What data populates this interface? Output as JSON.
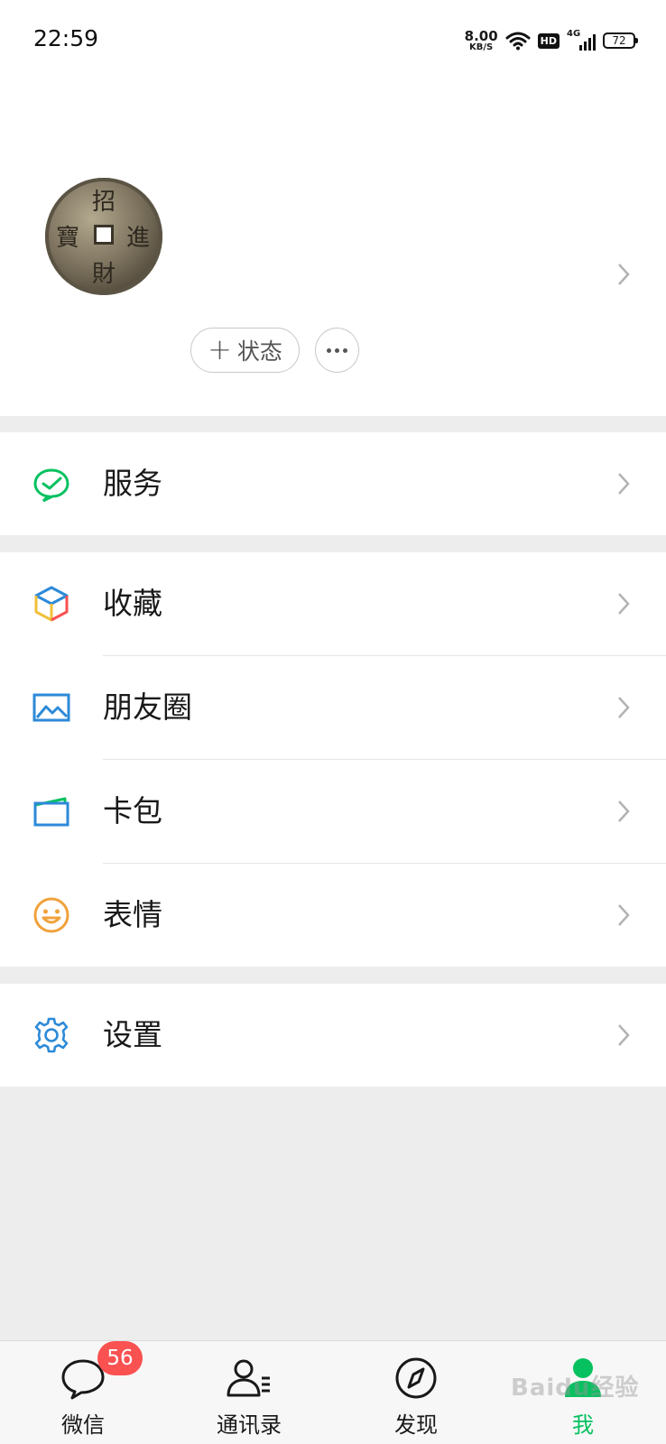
{
  "status_bar": {
    "time": "22:59",
    "net_speed_value": "8.00",
    "net_speed_unit": "KB/S",
    "hd_label": "HD",
    "network_label": "4G",
    "battery_level": "72"
  },
  "profile": {
    "avatar_chars": [
      "招",
      "進",
      "財",
      "寶"
    ],
    "status_button_plus": "+",
    "status_button_label": "状态"
  },
  "menu": {
    "services_label": "服务",
    "favorites_label": "收藏",
    "moments_label": "朋友圈",
    "cards_label": "卡包",
    "stickers_label": "表情",
    "settings_label": "设置"
  },
  "tab_bar": {
    "chats_label": "微信",
    "chats_badge": "56",
    "contacts_label": "通讯录",
    "discover_label": "发现",
    "me_label": "我"
  },
  "watermark": "Baidu经验",
  "colors": {
    "accent_green": "#07c160",
    "badge_red": "#fa5151",
    "background_gray": "#ededed",
    "icon_blue": "#2c8ad8",
    "icon_orange": "#f0a23b"
  }
}
